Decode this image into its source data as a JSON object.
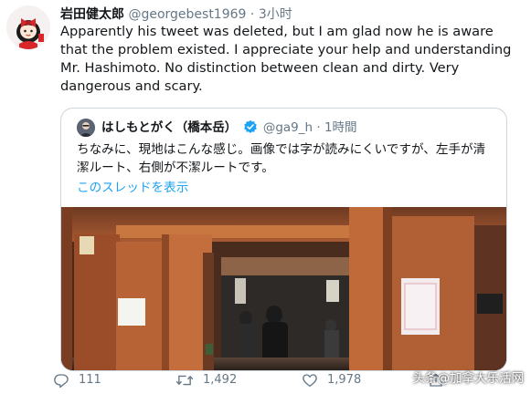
{
  "tweet": {
    "author_name": "岩田健太郎",
    "handle": "@georgebest1969",
    "separator": "·",
    "time": "3小时",
    "text": "Apparently his tweet was deleted, but I am glad now he is aware that the problem existed. I appreciate your help and understanding Mr. Hashimoto. No distinction between clean and dirty. Very dangerous and scary."
  },
  "quoted_tweet": {
    "author_name": "はしもとがく（橋本岳）",
    "handle": "@ga9_h",
    "separator": "·",
    "time": "1時間",
    "text": "ちなみに、現地はこんな感じ。画像では字が読みにくいですが、左手が清潔ルート、右側が不潔ルートです。",
    "thread_link": "このスレッドを表示"
  },
  "actions": {
    "reply_count": "111",
    "retweet_count": "1,492",
    "like_count": "1,978"
  },
  "watermark": "头条@加拿大乐活网",
  "icons": {
    "reply": "reply-icon",
    "retweet": "retweet-icon",
    "like": "heart-icon",
    "share": "share-icon",
    "verified": "verified-badge-icon"
  },
  "colors": {
    "link": "#1da1f2",
    "verified": "#1da1f2",
    "secondary_text": "#657786",
    "border": "#ccd6dd"
  }
}
